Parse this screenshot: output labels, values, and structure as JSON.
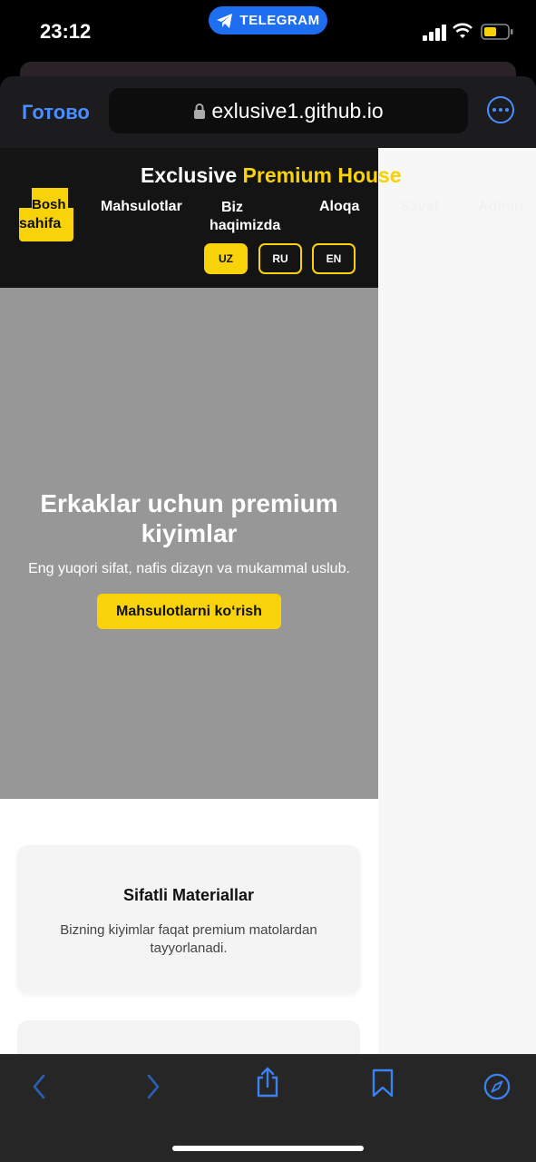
{
  "status_bar": {
    "time": "23:12",
    "telegram_label": "TELEGRAM"
  },
  "browser": {
    "done_label": "Готово",
    "url": "exlusive1.github.io"
  },
  "site": {
    "brand_white": "Exclusive",
    "brand_yellow": "Premium House",
    "nav": {
      "home_line1": "Bosh",
      "home_line2": "sahifa",
      "products": "Mahsulotlar",
      "about_line1": "Biz",
      "about_line2": "haqimizda",
      "contact": "Aloqa",
      "cart": "Savat",
      "admin": "Admin"
    },
    "languages": [
      {
        "code": "UZ",
        "active": true
      },
      {
        "code": "RU",
        "active": false
      },
      {
        "code": "EN",
        "active": false
      }
    ],
    "hero": {
      "title": "Erkaklar uchun premium kiyimlar",
      "subtitle": "Eng yuqori sifat, nafis dizayn va mukammal uslub.",
      "cta": "Mahsulotlarni ko‘rish"
    },
    "features": [
      {
        "title": "Sifatli Materiallar",
        "text": "Bizning kiyimlar faqat premium matolardan tayyorlanadi."
      }
    ]
  },
  "colors": {
    "accent": "#f9d30a",
    "link_blue": "#4a8dff",
    "hero_bg": "#979797",
    "header_bg": "#141414"
  }
}
